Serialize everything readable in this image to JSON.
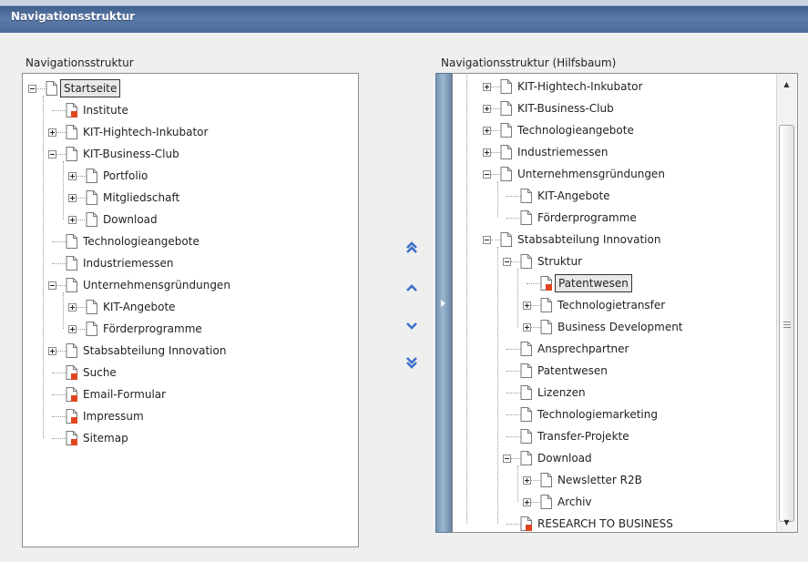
{
  "window": {
    "title": "Navigationsstruktur"
  },
  "left_panel": {
    "label": "Navigationsstruktur",
    "nodes": [
      {
        "label": "Startseite",
        "depth": 0,
        "exp": "minus",
        "icon": "page-icon",
        "selected": true
      },
      {
        "label": "Institute",
        "depth": 1,
        "exp": "",
        "icon": "page-red-icon"
      },
      {
        "label": "KIT-Hightech-Inkubator",
        "depth": 1,
        "exp": "plus",
        "icon": "page-icon"
      },
      {
        "label": "KIT-Business-Club",
        "depth": 1,
        "exp": "minus",
        "icon": "page-icon"
      },
      {
        "label": "Portfolio",
        "depth": 2,
        "exp": "plus",
        "icon": "page-icon"
      },
      {
        "label": "Mitgliedschaft",
        "depth": 2,
        "exp": "plus",
        "icon": "page-icon"
      },
      {
        "label": "Download",
        "depth": 2,
        "exp": "plus",
        "icon": "page-icon"
      },
      {
        "label": "Technologieangebote",
        "depth": 1,
        "exp": "",
        "icon": "page-icon"
      },
      {
        "label": "Industriemessen",
        "depth": 1,
        "exp": "",
        "icon": "page-icon"
      },
      {
        "label": "Unternehmensgründungen",
        "depth": 1,
        "exp": "minus",
        "icon": "page-icon"
      },
      {
        "label": "KIT-Angebote",
        "depth": 2,
        "exp": "plus",
        "icon": "page-icon"
      },
      {
        "label": "Förderprogramme",
        "depth": 2,
        "exp": "plus",
        "icon": "page-icon"
      },
      {
        "label": "Stabsabteilung Innovation",
        "depth": 1,
        "exp": "plus",
        "icon": "page-icon"
      },
      {
        "label": "Suche",
        "depth": 1,
        "exp": "",
        "icon": "page-red-icon"
      },
      {
        "label": "Email-Formular",
        "depth": 1,
        "exp": "",
        "icon": "page-red-icon"
      },
      {
        "label": "Impressum",
        "depth": 1,
        "exp": "",
        "icon": "page-red-icon"
      },
      {
        "label": "Sitemap",
        "depth": 1,
        "exp": "",
        "icon": "page-red-icon"
      }
    ]
  },
  "right_panel": {
    "label": "Navigationsstruktur (Hilfsbaum)",
    "nodes": [
      {
        "label": "KIT-Hightech-Inkubator",
        "depth": 1,
        "exp": "plus",
        "icon": "page-icon"
      },
      {
        "label": "KIT-Business-Club",
        "depth": 1,
        "exp": "plus",
        "icon": "page-icon"
      },
      {
        "label": "Technologieangebote",
        "depth": 1,
        "exp": "plus",
        "icon": "page-icon"
      },
      {
        "label": "Industriemessen",
        "depth": 1,
        "exp": "plus",
        "icon": "page-icon"
      },
      {
        "label": "Unternehmensgründungen",
        "depth": 1,
        "exp": "minus",
        "icon": "page-icon"
      },
      {
        "label": "KIT-Angebote",
        "depth": 2,
        "exp": "",
        "icon": "page-icon"
      },
      {
        "label": "Förderprogramme",
        "depth": 2,
        "exp": "",
        "icon": "page-icon"
      },
      {
        "label": "Stabsabteilung Innovation",
        "depth": 1,
        "exp": "minus",
        "icon": "page-icon"
      },
      {
        "label": "Struktur",
        "depth": 2,
        "exp": "minus",
        "icon": "page-icon"
      },
      {
        "label": "Patentwesen",
        "depth": 3,
        "exp": "",
        "icon": "page-red-icon",
        "selected": true
      },
      {
        "label": "Technologietransfer",
        "depth": 3,
        "exp": "plus",
        "icon": "page-icon"
      },
      {
        "label": "Business Development",
        "depth": 3,
        "exp": "plus",
        "icon": "page-icon"
      },
      {
        "label": "Ansprechpartner",
        "depth": 2,
        "exp": "",
        "icon": "page-icon"
      },
      {
        "label": "Patentwesen",
        "depth": 2,
        "exp": "",
        "icon": "page-icon"
      },
      {
        "label": "Lizenzen",
        "depth": 2,
        "exp": "",
        "icon": "page-icon"
      },
      {
        "label": "Technologiemarketing",
        "depth": 2,
        "exp": "",
        "icon": "page-icon"
      },
      {
        "label": "Transfer-Projekte",
        "depth": 2,
        "exp": "",
        "icon": "page-icon"
      },
      {
        "label": "Download",
        "depth": 2,
        "exp": "minus",
        "icon": "page-icon"
      },
      {
        "label": "Newsletter R2B",
        "depth": 3,
        "exp": "plus",
        "icon": "page-icon"
      },
      {
        "label": "Archiv",
        "depth": 3,
        "exp": "plus",
        "icon": "page-icon"
      },
      {
        "label": "RESEARCH TO BUSINESS",
        "depth": 2,
        "exp": "",
        "icon": "page-red-icon"
      }
    ]
  },
  "controls": {
    "move_top": "double-chevron-up-icon",
    "move_up": "chevron-up-icon",
    "move_down": "chevron-down-icon",
    "move_bottom": "double-chevron-down-icon"
  },
  "colors": {
    "title_bar": "#4d6c9c",
    "arrow_blue": "#3f6fc9",
    "page_badge_red": "#e0451f"
  }
}
